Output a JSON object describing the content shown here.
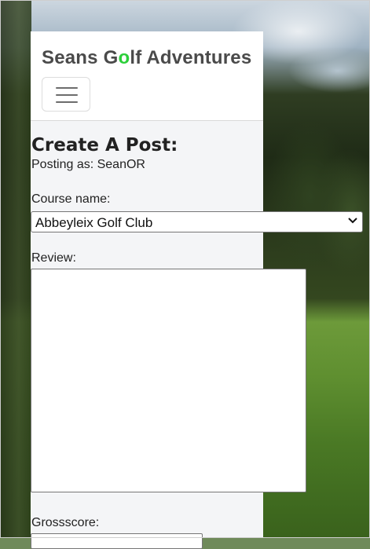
{
  "navbar": {
    "brand_part1": "Seans G",
    "brand_accent": "o",
    "brand_part2": "lf Adventures",
    "menu_icon": "hamburger-menu-icon"
  },
  "form": {
    "title": "Create A Post:",
    "posting_as": "Posting as: SeanOR",
    "course_label": "Course name:",
    "course_value": "Abbeyleix Golf Club",
    "review_label": "Review:",
    "review_value": "",
    "grossscore_label": "Grossscore:",
    "grossscore_value": ""
  },
  "colors": {
    "brand_text": "#4a4a4a",
    "brand_accent": "#2ccf3a",
    "panel_bg": "#f4f5f7"
  }
}
